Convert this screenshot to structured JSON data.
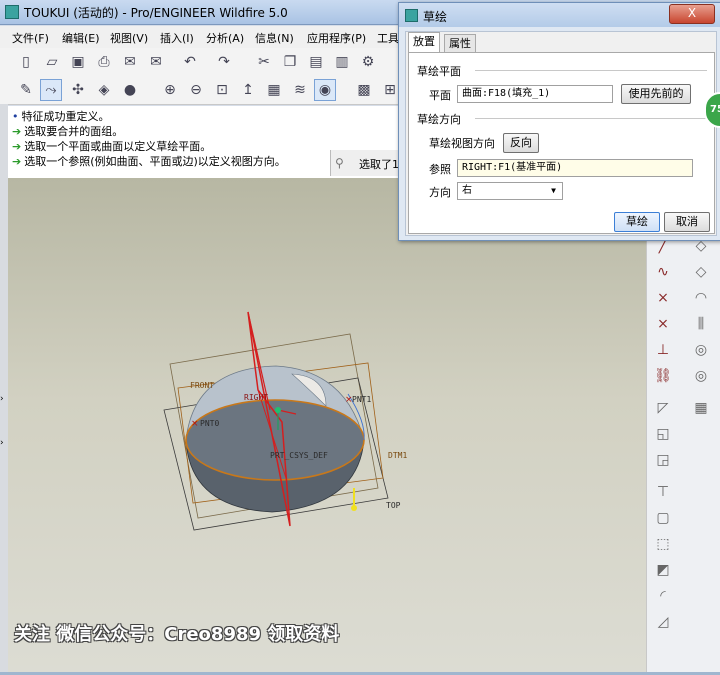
{
  "window": {
    "title": "TOUKUI (活动的) - Pro/ENGINEER Wildfire 5.0"
  },
  "menu": [
    "文件(F)",
    "编辑(E)",
    "视图(V)",
    "插入(I)",
    "分析(A)",
    "信息(N)",
    "应用程序(P)",
    "工具"
  ],
  "messages": [
    {
      "type": "info",
      "text": "特征成功重定义。"
    },
    {
      "type": "prompt",
      "text": "选取要合并的面组。"
    },
    {
      "type": "prompt",
      "text": "选取一个平面或曲面以定义草绘平面。"
    },
    {
      "type": "prompt",
      "text": "选取一个参照(例如曲面、平面或边)以定义视图方向。"
    }
  ],
  "status": {
    "selected": "选取了1"
  },
  "model_labels": {
    "front": "FRONT",
    "right": "RIGHT",
    "top": "TOP",
    "pnt0": "PNT0",
    "pnt1": "PNT1",
    "csys": "PRT_CSYS_DEF",
    "dtm1": "DTM1"
  },
  "dialog": {
    "title": "草绘",
    "close": "X",
    "tabs": [
      "放置",
      "属性"
    ],
    "sketch_plane": {
      "section": "草绘平面",
      "plane_label": "平面",
      "plane_value": "曲面:F18(填充_1)",
      "use_previous": "使用先前的"
    },
    "orientation": {
      "section": "草绘方向",
      "view_dir_label": "草绘视图方向",
      "flip": "反向",
      "ref_label": "参照",
      "ref_value": "RIGHT:F1(基准平面)",
      "dir_label": "方向",
      "dir_value": "右"
    },
    "ok": "草绘",
    "cancel": "取消"
  },
  "badge": "75",
  "watermark": "关注 微信公众号：Creo8989 领取资料"
}
